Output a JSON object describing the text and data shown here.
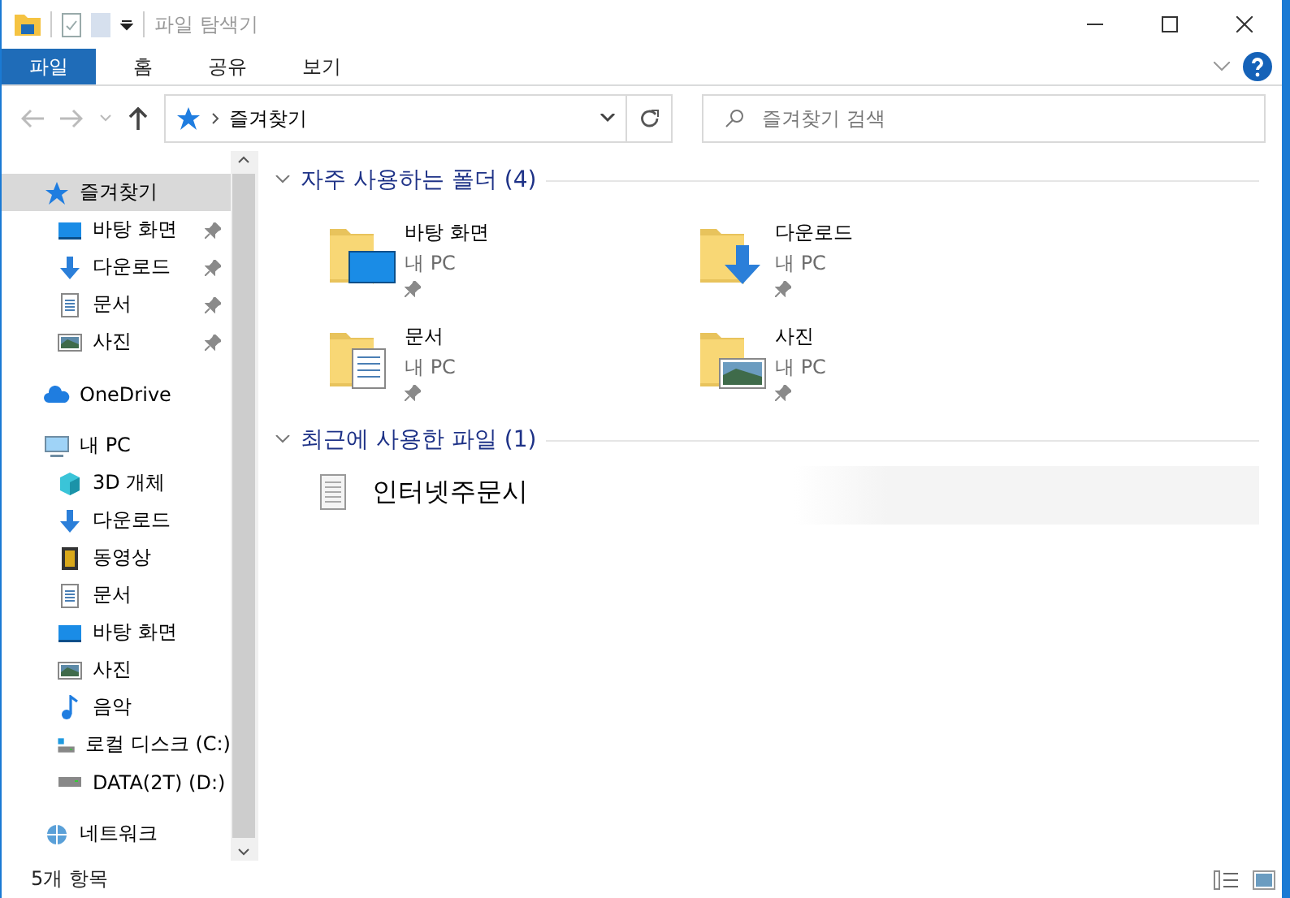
{
  "window": {
    "title": "파일 탐색기"
  },
  "ribbon_tabs": [
    {
      "label": "파일",
      "selected": true
    },
    {
      "label": "홈",
      "selected": false
    },
    {
      "label": "공유",
      "selected": false
    },
    {
      "label": "보기",
      "selected": false
    }
  ],
  "address": {
    "location": "즐겨찾기"
  },
  "search": {
    "placeholder": "즐겨찾기 검색"
  },
  "sidebar": {
    "items": [
      {
        "label": "즐겨찾기",
        "kind": "star",
        "selected": true,
        "children": [
          {
            "label": "바탕 화면",
            "kind": "desktop",
            "pinned": true,
            "selected": false
          },
          {
            "label": "다운로드",
            "kind": "download",
            "pinned": true,
            "selected": false
          },
          {
            "label": "문서",
            "kind": "document",
            "pinned": true,
            "selected": false
          },
          {
            "label": "사진",
            "kind": "picture",
            "pinned": true,
            "selected": false
          }
        ]
      },
      {
        "label": "OneDrive",
        "kind": "cloud",
        "selected": false
      },
      {
        "label": "내 PC",
        "kind": "pc",
        "selected": false,
        "children": [
          {
            "label": "3D 개체",
            "kind": "cube",
            "selected": false
          },
          {
            "label": "다운로드",
            "kind": "download",
            "selected": false
          },
          {
            "label": "동영상",
            "kind": "film",
            "selected": false
          },
          {
            "label": "문서",
            "kind": "document",
            "selected": false
          },
          {
            "label": "바탕 화면",
            "kind": "desktop",
            "selected": false
          },
          {
            "label": "사진",
            "kind": "picture",
            "selected": false
          },
          {
            "label": "음악",
            "kind": "music",
            "selected": false
          },
          {
            "label": "로컬 디스크 (C:)",
            "kind": "windrive",
            "selected": false
          },
          {
            "label": "DATA(2T) (D:)",
            "kind": "drive",
            "selected": false
          }
        ]
      },
      {
        "label": "네트워크",
        "kind": "globe",
        "selected": false
      }
    ]
  },
  "frequent": {
    "heading": "자주 사용하는 폴더 (4)",
    "folders": [
      {
        "name": "바탕 화면",
        "location": "내 PC",
        "pinned": true,
        "kind": "desktop"
      },
      {
        "name": "다운로드",
        "location": "내 PC",
        "pinned": true,
        "kind": "download"
      },
      {
        "name": "문서",
        "location": "내 PC",
        "pinned": true,
        "kind": "document"
      },
      {
        "name": "사진",
        "location": "내 PC",
        "pinned": true,
        "kind": "picture"
      }
    ]
  },
  "recent": {
    "heading": "최근에 사용한 파일 (1)",
    "files": [
      {
        "name": "인터넷주문시"
      }
    ]
  },
  "status_bar": {
    "count": "5개 항목"
  }
}
